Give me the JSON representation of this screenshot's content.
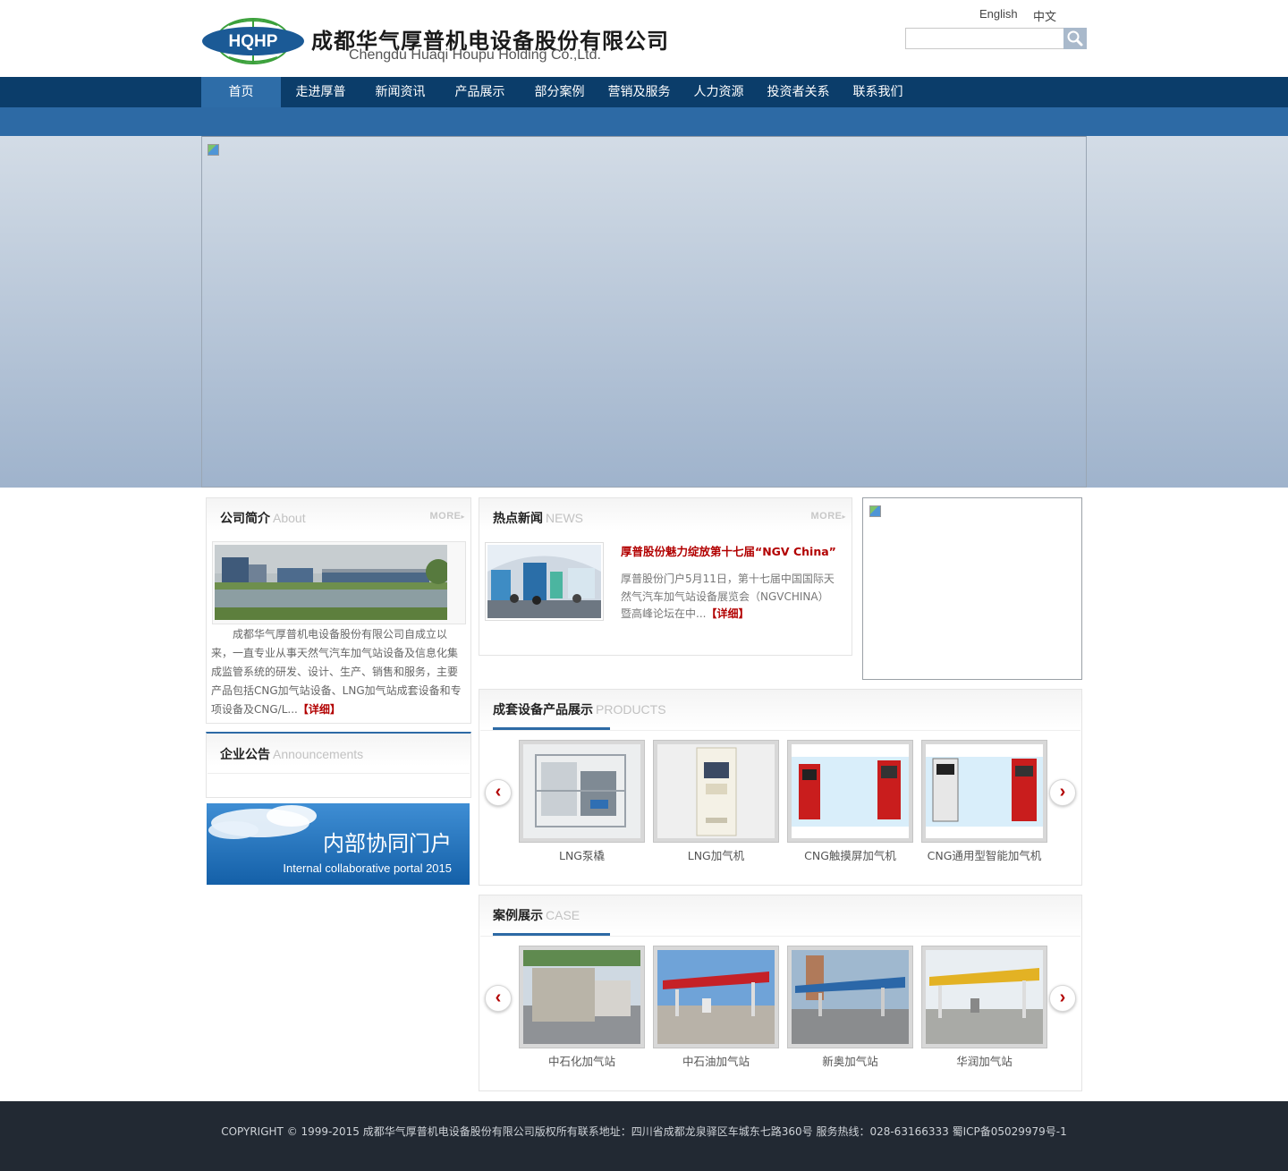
{
  "header": {
    "logo_text": "HQHP",
    "company_cn": "成都华气厚普机电设备股份有限公司",
    "company_en": "Chengdu Huaqi Houpu Holding Co.,Ltd.",
    "lang_english": "English",
    "lang_chinese": "中文",
    "search_placeholder": ""
  },
  "nav": {
    "items": [
      {
        "label": "首页",
        "active": true
      },
      {
        "label": "走进厚普"
      },
      {
        "label": "新闻资讯"
      },
      {
        "label": "产品展示"
      },
      {
        "label": "部分案例"
      },
      {
        "label": "营销及服务"
      },
      {
        "label": "人力资源"
      },
      {
        "label": "投资者关系"
      },
      {
        "label": "联系我们"
      }
    ]
  },
  "about": {
    "title": "公司简介",
    "sub": "About",
    "more": "MORE",
    "text": "成都华气厚普机电设备股份有限公司自成立以来，一直专业从事天然气汽车加气站设备及信息化集成监管系统的研发、设计、生产、销售和服务，主要产品包括CNG加气站设备、LNG加气站成套设备和专项设备及CNG/L...",
    "detail": "【详细】"
  },
  "news": {
    "title": "热点新闻",
    "sub": "NEWS",
    "more": "MORE",
    "headline": "厚普股份魅力绽放第十七届“NGV China”",
    "text": "厚普股份门户5月11日，第十七届中国国际天然气汽车加气站设备展览会（NGVCHINA）暨高峰论坛在中...",
    "detail": "【详细】"
  },
  "announcements": {
    "title": "企业公告",
    "sub": "Announcements"
  },
  "portal": {
    "title_cn": "内部协同门户",
    "title_en": "Internal collaborative portal  2015"
  },
  "products": {
    "title": "成套设备产品展示",
    "sub": "PRODUCTS",
    "items": [
      "LNG泵橇",
      "LNG加气机",
      "CNG触摸屏加气机",
      "CNG通用型智能加气机"
    ]
  },
  "cases": {
    "title": "案例展示",
    "sub": "CASE",
    "items": [
      "中石化加气站",
      "中石油加气站",
      "新奥加气站",
      "华润加气站"
    ]
  },
  "arrows": {
    "prev": "‹",
    "next": "›"
  },
  "footer": {
    "text": "COPYRIGHT © 1999-2015 成都华气厚普机电设备股份有限公司版权所有联系地址：四川省成都龙泉驿区车城东七路360号 服务热线：028-63166333 蜀ICP备05029979号-1"
  },
  "colors": {
    "nav_bg": "#0b3d6a",
    "nav_active": "#2e6da8",
    "accent_red": "#b20000",
    "footer_bg": "#222933"
  }
}
